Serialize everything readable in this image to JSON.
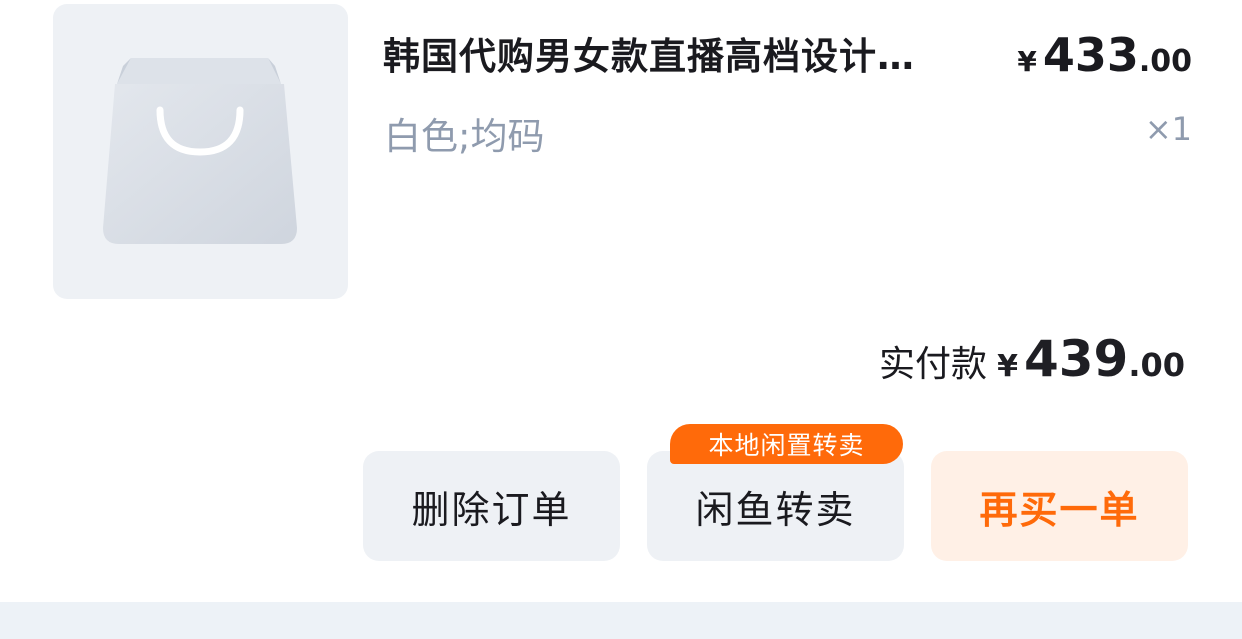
{
  "product": {
    "title": "韩国代购男女款直播高档设计…",
    "sku": "白色;均码",
    "qty": "×1",
    "price_currency": "¥",
    "price_int": "433",
    "price_dec": ".00",
    "image_icon": "shopping-bag-icon"
  },
  "total": {
    "label": "实付款",
    "currency": "¥",
    "int": "439",
    "dec": ".00"
  },
  "actions": {
    "delete_label": "删除订单",
    "resell_label": "闲鱼转卖",
    "resell_badge": "本地闲置转卖",
    "rebuy_label": "再买一单"
  },
  "colors": {
    "accent": "#ff6a0a",
    "accent_bg": "#fff0e6",
    "button_bg": "#eef1f5",
    "muted_text": "#8f9bae"
  }
}
